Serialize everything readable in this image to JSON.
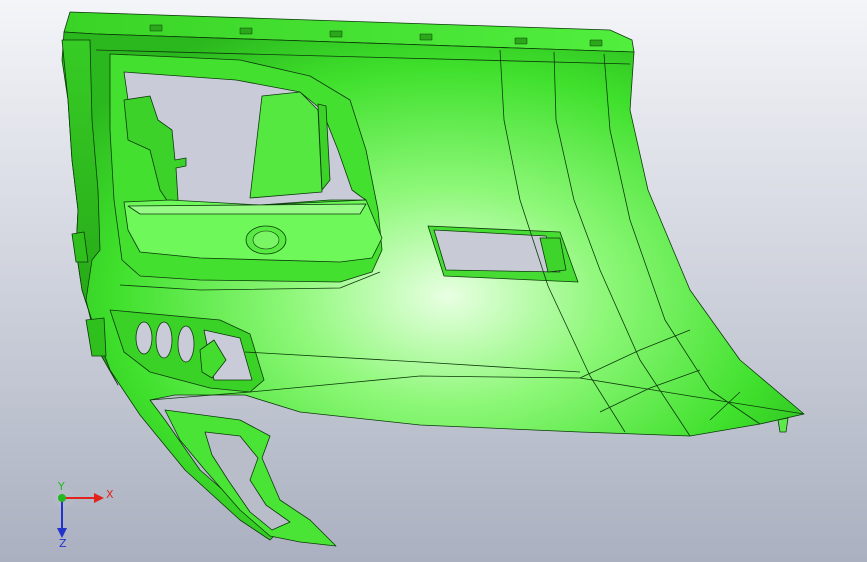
{
  "viewport": {
    "background_top": "#f4f5f9",
    "background_bottom": "#aab0c0",
    "model_name": "",
    "model_color_light": "#d8ffd0",
    "model_color_mid": "#5ef04a",
    "model_color_dark": "#2cb81e",
    "edge_color": "#0c3a0a"
  },
  "triad": {
    "x_label": "X",
    "y_label": "Y",
    "z_label": "Z",
    "x_color": "#e0241c",
    "y_color": "#22b822",
    "z_color": "#2233cc"
  }
}
